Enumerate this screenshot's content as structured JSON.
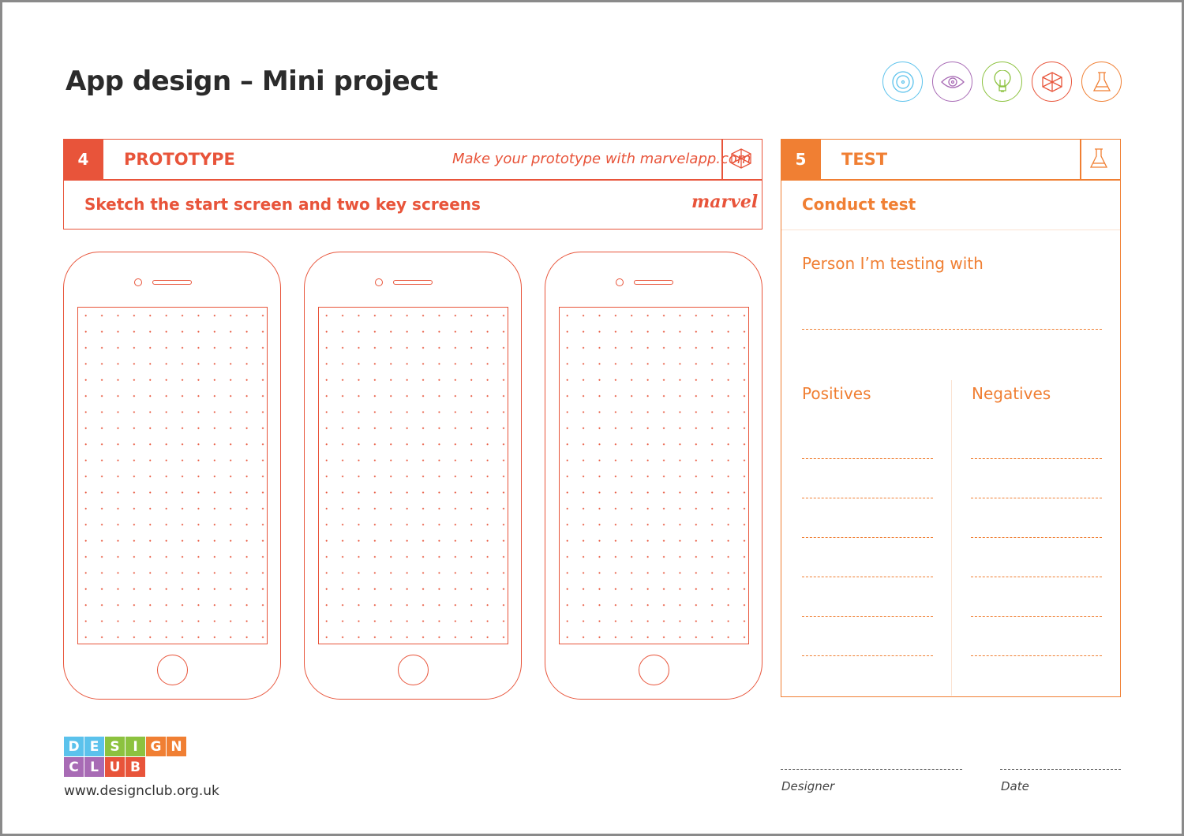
{
  "title": "App design – Mini project",
  "icons": [
    {
      "name": "target-icon",
      "color": "#5bc2ec"
    },
    {
      "name": "eye-icon",
      "color": "#a86bb5"
    },
    {
      "name": "lightbulb-icon",
      "color": "#8cc23f"
    },
    {
      "name": "cube-icon",
      "color": "#e8543a"
    },
    {
      "name": "flask-icon",
      "color": "#f07f33"
    }
  ],
  "prototype": {
    "number": "4",
    "heading": "PROTOTYPE",
    "hint": "Make your prototype with marvelapp.com",
    "instruction": "Sketch the start screen and two key screens",
    "logo": "marvel",
    "color": "#e8543a"
  },
  "test": {
    "number": "5",
    "heading": "TEST",
    "subheading": "Conduct test",
    "person_label": "Person I’m testing with",
    "positives_label": "Positives",
    "negatives_label": "Negatives",
    "color": "#f07f33"
  },
  "footer": {
    "logo_row1": [
      "D",
      "E",
      "S",
      "I",
      "G",
      "N"
    ],
    "logo_row2": [
      "C",
      "L",
      "U",
      "B"
    ],
    "url": "www.designclub.org.uk",
    "designer_label": "Designer",
    "date_label": "Date"
  }
}
